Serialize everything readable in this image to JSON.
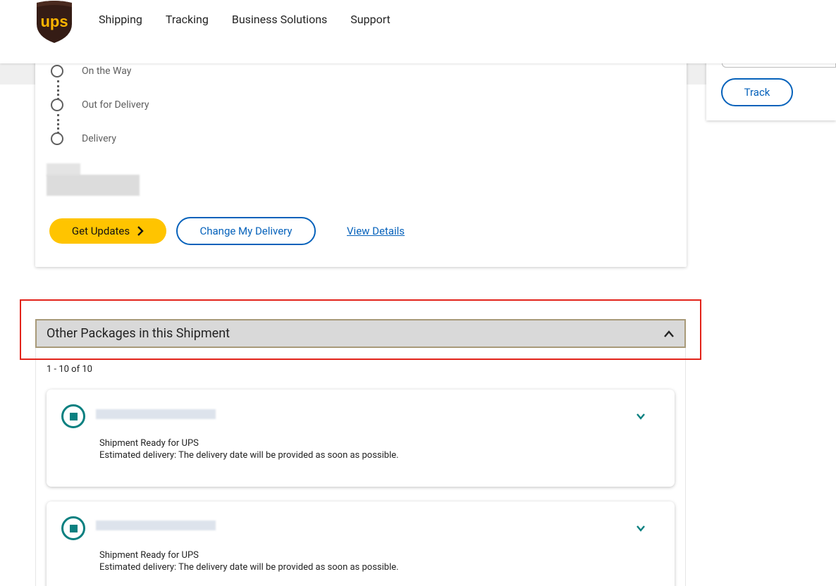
{
  "brand": {
    "logo_text": "ups",
    "logo_color": "#351c15",
    "logo_accent": "#ffb500"
  },
  "nav": {
    "items": [
      {
        "label": "Shipping"
      },
      {
        "label": "Tracking"
      },
      {
        "label": "Business Solutions"
      },
      {
        "label": "Support"
      }
    ]
  },
  "progress": {
    "steps": [
      {
        "label": "On the Way"
      },
      {
        "label": "Out for Delivery"
      },
      {
        "label": "Delivery"
      }
    ]
  },
  "actions": {
    "get_updates": "Get Updates",
    "change_delivery": "Change My Delivery",
    "view_details": "View Details"
  },
  "sidebar": {
    "track_button": "Track"
  },
  "other_packages": {
    "title": "Other Packages in this Shipment",
    "count_text": "1 - 10 of 10",
    "packages": [
      {
        "status": "Shipment Ready for UPS",
        "estimate": "Estimated delivery: The delivery date will be provided as soon as possible."
      },
      {
        "status": "Shipment Ready for UPS",
        "estimate": "Estimated delivery: The delivery date will be provided as soon as possible."
      }
    ]
  },
  "colors": {
    "primary_blue": "#0662bb",
    "cta_yellow": "#ffc400",
    "status_teal": "#0a8080",
    "highlight_red": "#e2231a",
    "accordion_bg": "#d9d9d9"
  }
}
